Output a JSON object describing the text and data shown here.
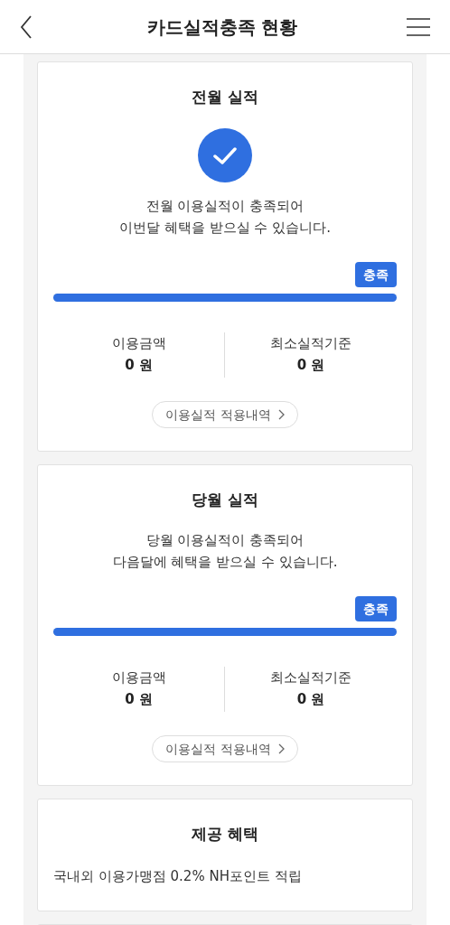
{
  "header": {
    "title": "카드실적충족 현황"
  },
  "performance_cards": [
    {
      "title": "전월 실적",
      "kind": "with-icon",
      "message_lines": [
        "전월 이용실적이 충족되어",
        "이번달 혜택을 받으실 수 있습니다."
      ],
      "badge": "충족",
      "level": 1,
      "stats": [
        {
          "label": "이용금액",
          "value": "0 원"
        },
        {
          "label": "최소실적기준",
          "value": "0 원"
        }
      ],
      "history_button": "이용실적 적용내역"
    },
    {
      "title": "당월 실적",
      "kind": "text-only",
      "message_lines": [
        "당월 이용실적이 충족되어",
        "다음달에 혜택을 받으실 수 있습니다."
      ],
      "badge": "충족",
      "level": 1,
      "stats": [
        {
          "label": "이용금액",
          "value": "0 원"
        },
        {
          "label": "최소실적기준",
          "value": "0 원"
        }
      ],
      "history_button": "이용실적 적용내역"
    }
  ],
  "benefit_card": {
    "title": "제공 혜택",
    "text": "국내외 이용가맹점 0.2% NH포인트 적립"
  }
}
